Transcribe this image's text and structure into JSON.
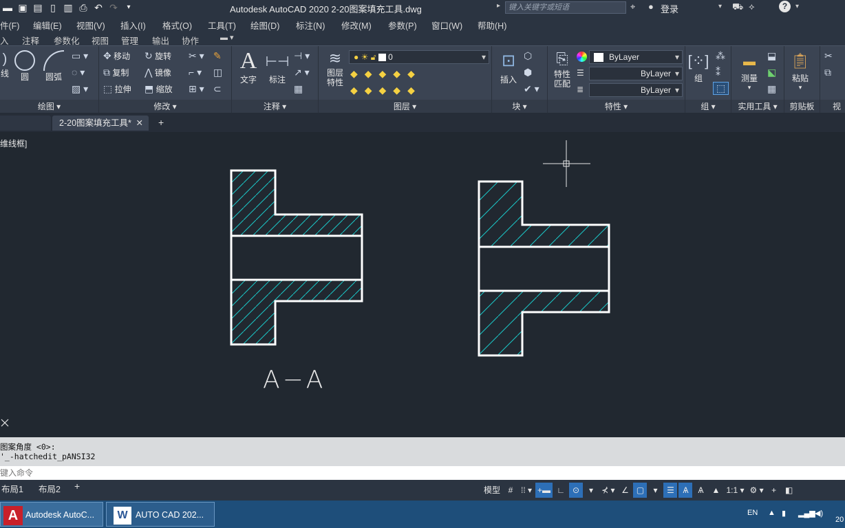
{
  "title_bar": {
    "app_title": "Autodesk AutoCAD 2020    2-20图案填充工具.dwg",
    "search_placeholder": "键入关键字或短语",
    "login": "登录"
  },
  "menu": [
    "件(F)",
    "编辑(E)",
    "视图(V)",
    "插入(I)",
    "格式(O)",
    "工具(T)",
    "绘图(D)",
    "标注(N)",
    "修改(M)",
    "参数(P)",
    "窗口(W)",
    "帮助(H)"
  ],
  "ribbon_tabs": [
    "入",
    "注释",
    "参数化",
    "视图",
    "管理",
    "输出",
    "协作"
  ],
  "ribbon": {
    "draw": {
      "title": "绘图",
      "line": "线",
      "circle": "圆",
      "arc": "圆弧"
    },
    "modify": {
      "title": "修改",
      "move": "移动",
      "rotate": "旋转",
      "copy": "复制",
      "mirror": "镜像",
      "stretch": "拉伸",
      "scale": "缩放"
    },
    "annotation": {
      "title": "注释",
      "text": "文字",
      "dimension": "标注"
    },
    "layers": {
      "title": "图层",
      "props": "图层\n特性",
      "props1": "图层",
      "props2": "特性",
      "current_layer": "0"
    },
    "block": {
      "title": "块",
      "insert": "插入"
    },
    "properties": {
      "title": "特性",
      "match1": "特性",
      "match2": "匹配",
      "color": "ByLayer",
      "linetype": "ByLayer",
      "lineweight": "ByLayer"
    },
    "groups": {
      "title": "组",
      "group": "组"
    },
    "utilities": {
      "title": "实用工具",
      "measure": "测量"
    },
    "clipboard": {
      "title": "剪贴板",
      "paste": "粘贴"
    },
    "view_cut": "视"
  },
  "document_tab": "2-20图案填充工具*",
  "viewport_label": "维线框]",
  "drawing": {
    "section_label": "A−A",
    "hatch_color": "#19c9c9",
    "outline_color": "#ffffff"
  },
  "command_history": [
    "图案角度 <0>:",
    "'_-hatchedit_pANSI32"
  ],
  "command_prompt": "键入命令",
  "layout_tabs": [
    "布局1",
    "布局2"
  ],
  "status_bar": {
    "model": "模型",
    "scale": "1:1"
  },
  "taskbar": {
    "tasks": [
      "Autodesk AutoC...",
      "AUTO  CAD 202..."
    ],
    "lang": "EN",
    "clock_fragment": "20"
  }
}
